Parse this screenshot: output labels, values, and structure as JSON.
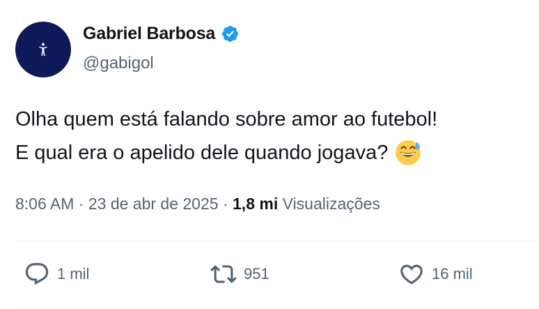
{
  "author": {
    "display_name": "Gabriel Barbosa",
    "handle": "@gabigol",
    "verified_icon": "verified-badge-icon",
    "accent_color": "#1d9bf0"
  },
  "tweet": {
    "lines": [
      "Olha quem está falando sobre amor ao futebol!",
      "E qual era o apelido dele quando jogava?"
    ],
    "emoji": "grinning-face-with-sweat-emoji"
  },
  "meta": {
    "time": "8:06 AM",
    "separator": " · ",
    "date": "23 de abr de 2025",
    "views_count": "1,8 mi",
    "views_label": "Visualizações"
  },
  "actions": {
    "reply": {
      "icon": "reply-icon",
      "count": "1 mil"
    },
    "retweet": {
      "icon": "retweet-icon",
      "count": "951"
    },
    "like": {
      "icon": "heart-icon",
      "count": "16 mil"
    }
  }
}
